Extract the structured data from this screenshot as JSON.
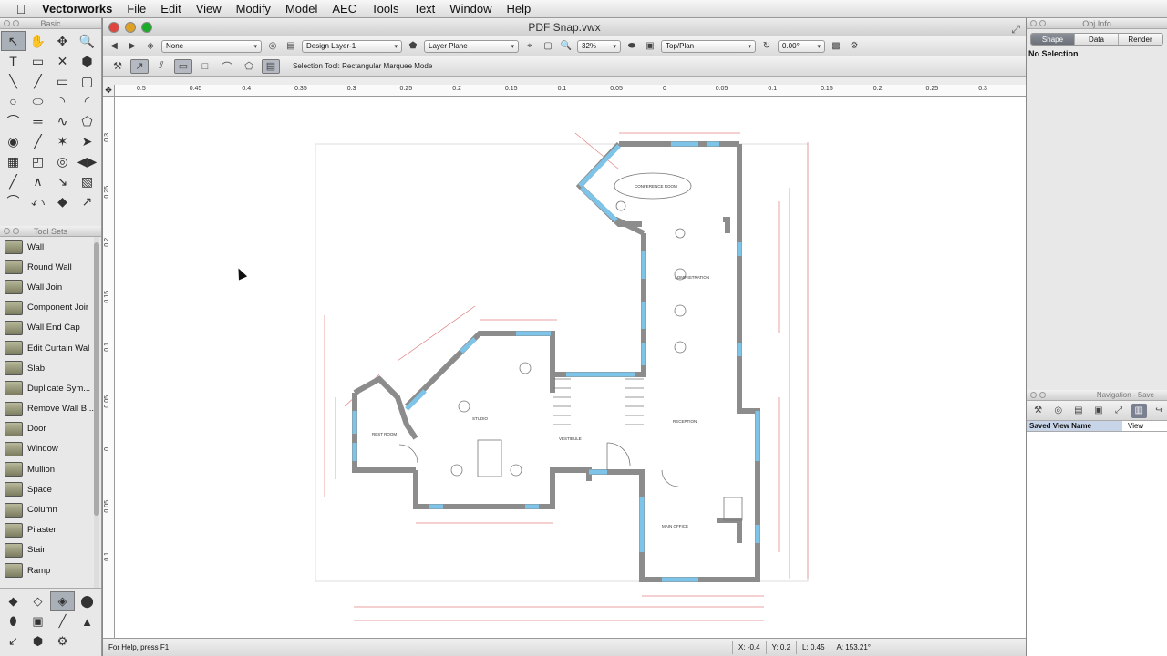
{
  "menubar": {
    "app": "Vectorworks",
    "items": [
      "File",
      "Edit",
      "View",
      "Modify",
      "Model",
      "AEC",
      "Tools",
      "Text",
      "Window",
      "Help"
    ]
  },
  "basic_palette": {
    "title": "Basic",
    "tools": [
      "selection-tool",
      "pan-tool",
      "flyover-tool",
      "zoom-tool",
      "text-tool",
      "callout-tool",
      "locus-tool",
      "2d-locus-tool",
      "line-tool",
      "dimension-tool",
      "rectangle-tool",
      "rounded-rect-tool",
      "circle-tool",
      "oval-tool",
      "arc-tool",
      "quarter-arc-tool",
      "polyline-tool",
      "double-line-tool",
      "freehand-tool",
      "polygon-tool",
      "eyedropper-tool",
      "trim-tool",
      "attribute-mapping-tool",
      "reshape-tool",
      "symbol-insert-tool",
      "split-tool",
      "offset-tool",
      "mirror-tool",
      "fillet-tool",
      "chamfer-tool",
      "connect-tool",
      "clip-tool",
      "spiral-tool",
      "bezier-tool",
      "cubic-spline-tool",
      "wall-tool"
    ]
  },
  "tool_sets": {
    "title": "Tool Sets",
    "items": [
      {
        "label": "Wall"
      },
      {
        "label": "Round Wall"
      },
      {
        "label": "Wall Join"
      },
      {
        "label": "Component Joir"
      },
      {
        "label": "Wall End Cap"
      },
      {
        "label": "Edit Curtain Wal"
      },
      {
        "label": "Slab"
      },
      {
        "label": "Duplicate Sym..."
      },
      {
        "label": "Remove Wall B..."
      },
      {
        "label": "Door"
      },
      {
        "label": "Window"
      },
      {
        "label": "Mullion"
      },
      {
        "label": "Space"
      },
      {
        "label": "Column"
      },
      {
        "label": "Pilaster"
      },
      {
        "label": "Stair"
      },
      {
        "label": "Ramp"
      }
    ]
  },
  "document": {
    "title": "PDF Snap.vwx",
    "view_bar": {
      "class": "None",
      "layer": "Design Layer-1",
      "plane": "Layer Plane",
      "zoom": "32%",
      "view": "Top/Plan",
      "rotation": "0.00°"
    },
    "mode_bar_text": "Selection Tool: Rectangular Marquee Mode",
    "ruler_h": [
      "0.5",
      "0.45",
      "0.4",
      "0.35",
      "0.3",
      "0.25",
      "0.2",
      "0.15",
      "0.1",
      "0.05",
      "0",
      "0.05",
      "0.1",
      "0.15",
      "0.2",
      "0.25",
      "0.3"
    ],
    "ruler_v": [
      "0.3",
      "0.25",
      "0.2",
      "0.15",
      "0.1",
      "0.05",
      "0",
      "0.05",
      "0.1"
    ],
    "plan_labels": {
      "conference": "CONFERENCE ROOM",
      "administration": "ADMINISTRATION",
      "studio": "STUDIO",
      "rest_room": "REST ROOM",
      "vestibule": "VESTIBULE",
      "reception": "RECEPTION",
      "main_office": "MAIN OFFICE"
    }
  },
  "status_bar": {
    "help": "For Help, press F1",
    "x": "X: -0.4",
    "y": "Y: 0.2",
    "l": "L: 0.45",
    "a": "A: 153.21°"
  },
  "object_info": {
    "title": "Obj Info",
    "tabs": [
      "Shape",
      "Data",
      "Render"
    ],
    "active_tab": "Shape",
    "selection": "No Selection"
  },
  "navigation": {
    "title": "Navigation - Save",
    "col1": "Saved View Name",
    "col2": "View"
  }
}
